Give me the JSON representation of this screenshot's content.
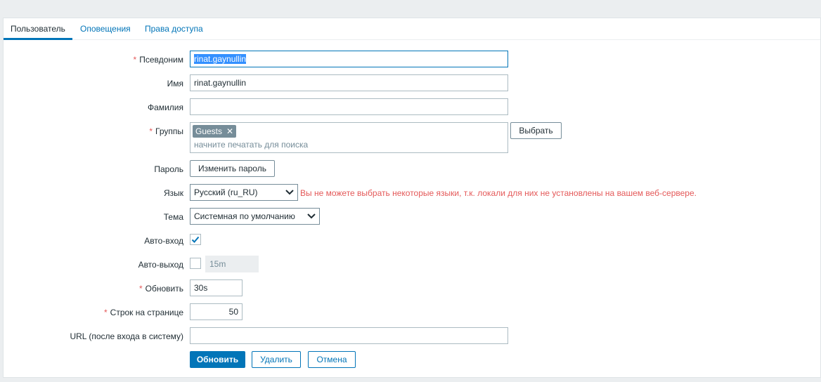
{
  "tabs": [
    {
      "label": "Пользователь",
      "active": true
    },
    {
      "label": "Оповещения",
      "active": false
    },
    {
      "label": "Права доступа",
      "active": false
    }
  ],
  "form": {
    "alias": {
      "label": "Псевдоним",
      "required": true,
      "value": "rinat.gaynullin"
    },
    "name": {
      "label": "Имя",
      "value": "rinat.gaynullin"
    },
    "surname": {
      "label": "Фамилия",
      "value": ""
    },
    "groups": {
      "label": "Группы",
      "required": true,
      "chips": [
        "Guests"
      ],
      "placeholder": "начните печатать для поиска",
      "select_button": "Выбрать"
    },
    "password": {
      "label": "Пароль",
      "button": "Изменить пароль"
    },
    "language": {
      "label": "Язык",
      "value": "Русский (ru_RU)",
      "warning": "Вы не можете выбрать некоторые языки, т.к. локали для них не установлены на вашем веб-сервере."
    },
    "theme": {
      "label": "Тема",
      "value": "Системная по умолчанию"
    },
    "autologin": {
      "label": "Авто-вход",
      "checked": true
    },
    "autologout": {
      "label": "Авто-выход",
      "checked": false,
      "value": "15m"
    },
    "refresh": {
      "label": "Обновить",
      "required": true,
      "value": "30s"
    },
    "rows_per_page": {
      "label": "Строк на странице",
      "required": true,
      "value": "50"
    },
    "url": {
      "label": "URL (после входа в систему)",
      "value": ""
    }
  },
  "actions": {
    "update": "Обновить",
    "delete": "Удалить",
    "cancel": "Отмена"
  },
  "colors": {
    "accent": "#0275b8",
    "error": "#e45959",
    "chip": "#768d99"
  }
}
